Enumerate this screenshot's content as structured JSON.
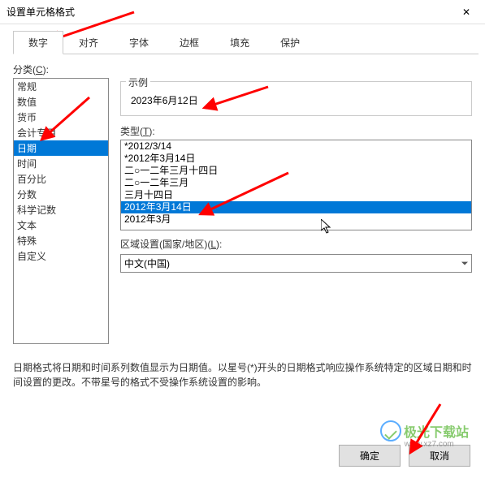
{
  "window": {
    "title": "设置单元格格式",
    "close_glyph": "✕"
  },
  "tabs": [
    "数字",
    "对齐",
    "字体",
    "边框",
    "填充",
    "保护"
  ],
  "active_tab_index": 0,
  "category": {
    "label_pre": "分类(",
    "label_key": "C",
    "label_post": "):",
    "items": [
      "常规",
      "数值",
      "货币",
      "会计专用",
      "日期",
      "时间",
      "百分比",
      "分数",
      "科学记数",
      "文本",
      "特殊",
      "自定义"
    ],
    "selected_index": 4
  },
  "example": {
    "label": "示例",
    "value": "2023年6月12日"
  },
  "type": {
    "label_pre": "类型(",
    "label_key": "T",
    "label_post": "):",
    "items": [
      "*2012/3/14",
      "*2012年3月14日",
      "二○一二年三月十四日",
      "二○一二年三月",
      "三月十四日",
      "2012年3月14日",
      "2012年3月"
    ],
    "selected_index": 5
  },
  "locale": {
    "label_pre": "区域设置(国家/地区)(",
    "label_key": "L",
    "label_post": "):",
    "value": "中文(中国)"
  },
  "description": "日期格式将日期和时间系列数值显示为日期值。以星号(*)开头的日期格式响应操作系统特定的区域日期和时间设置的更改。不带星号的格式不受操作系统设置的影响。",
  "buttons": {
    "ok": "确定",
    "cancel": "取消"
  },
  "watermark": {
    "t1": "极光下载站",
    "t2": "www.xz7.com"
  }
}
